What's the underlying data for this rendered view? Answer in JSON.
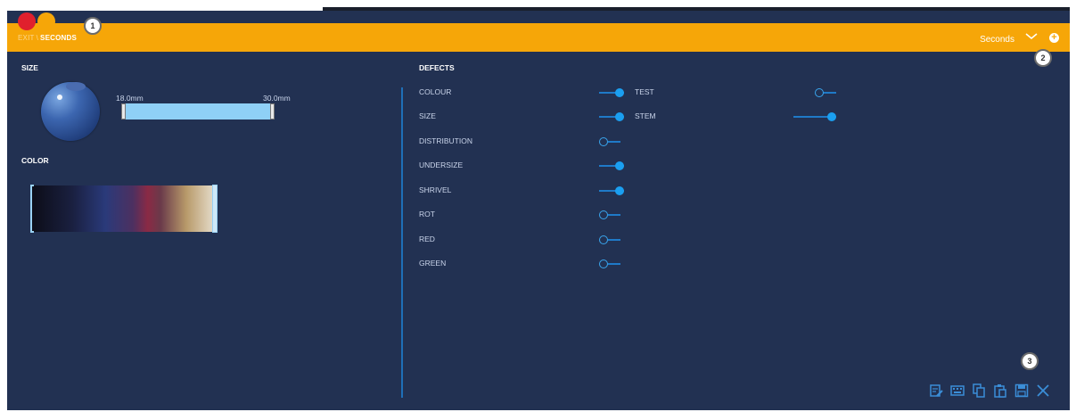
{
  "header": {
    "breadcrumb_root": "EXIT",
    "breadcrumb_separator": "\\",
    "breadcrumb_current": "SECONDS",
    "selected_value": "Seconds"
  },
  "callouts": {
    "one": "1",
    "two": "2",
    "three": "3"
  },
  "size": {
    "title": "SIZE",
    "min_label": "18.0mm",
    "max_label": "30.0mm"
  },
  "color": {
    "title": "COLOR"
  },
  "defects": {
    "title": "DEFECTS",
    "left": [
      {
        "label": "COLOUR",
        "on": true
      },
      {
        "label": "SIZE",
        "on": true
      },
      {
        "label": "DISTRIBUTION",
        "on": false
      },
      {
        "label": "UNDERSIZE",
        "on": true
      },
      {
        "label": "SHRIVEL",
        "on": true
      },
      {
        "label": "ROT",
        "on": false
      },
      {
        "label": "RED",
        "on": false
      },
      {
        "label": "GREEN",
        "on": false
      }
    ],
    "right": [
      {
        "label": "TEST",
        "on": false
      },
      {
        "label": "STEM",
        "on": true
      }
    ]
  },
  "toolbar_icons": [
    "edit-icon",
    "keyboard-icon",
    "copy-icon",
    "paste-icon",
    "save-icon",
    "close-icon"
  ],
  "colors": {
    "accent": "#f6a608",
    "panel": "#223152",
    "toggle_on": "#1b9ff0",
    "red": "#e0202d"
  }
}
